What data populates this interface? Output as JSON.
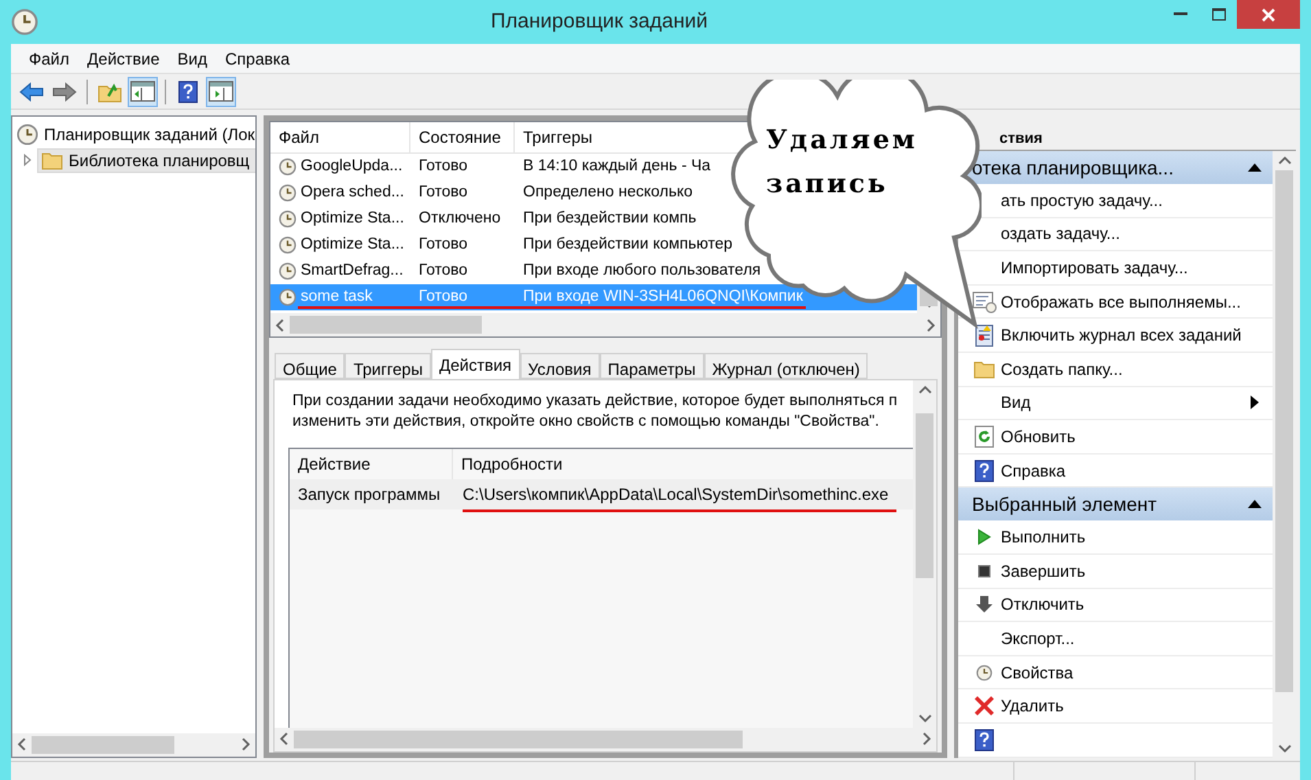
{
  "window": {
    "title": "Планировщик заданий"
  },
  "menu": [
    "Файл",
    "Действие",
    "Вид",
    "Справка"
  ],
  "toolbar": [
    {
      "kind": "back",
      "pressed": false
    },
    {
      "kind": "forward",
      "pressed": false
    },
    {
      "kind": "separator"
    },
    {
      "kind": "up",
      "pressed": false
    },
    {
      "kind": "tree",
      "pressed": true
    },
    {
      "kind": "separator"
    },
    {
      "kind": "help",
      "pressed": false
    },
    {
      "kind": "actions",
      "pressed": true
    }
  ],
  "tree": [
    {
      "label": "Планировщик заданий (Лок",
      "selected": false,
      "children": [
        {
          "label": "Библиотека планировщ",
          "selected": true,
          "expanded": false
        }
      ]
    }
  ],
  "task_table": {
    "columns": [
      "Файл",
      "Состояние",
      "Триггеры"
    ],
    "rows": [
      {
        "name": "GoogleUpda...",
        "status": "Готово",
        "trigger": "В 14:10 каждый день - Ча",
        "selected": false,
        "underlined": false
      },
      {
        "name": "Opera sched...",
        "status": "Готово",
        "trigger": "Определено несколько",
        "selected": false,
        "underlined": false
      },
      {
        "name": "Optimize Sta...",
        "status": "Отключено",
        "trigger": "При бездействии компь",
        "selected": false,
        "underlined": false
      },
      {
        "name": "Optimize Sta...",
        "status": "Готово",
        "trigger": "При бездействии компьютер",
        "selected": false,
        "underlined": false
      },
      {
        "name": "SmartDefrag...",
        "status": "Готово",
        "trigger": "При входе любого пользователя",
        "selected": false,
        "underlined": false
      },
      {
        "name": "some task",
        "status": "Готово",
        "trigger": "При входе WIN-3SH4L06QNQI\\Компик",
        "selected": true,
        "underlined": true
      }
    ]
  },
  "detail_tabs": [
    {
      "label": "Общие",
      "selected": false
    },
    {
      "label": "Триггеры",
      "selected": false
    },
    {
      "label": "Действия",
      "selected": true
    },
    {
      "label": "Условия",
      "selected": false
    },
    {
      "label": "Параметры",
      "selected": false
    },
    {
      "label": "Журнал (отключен)",
      "selected": false
    }
  ],
  "description_lines": [
    "При создании задачи необходимо указать действие, которое будет выполняться п",
    "изменить эти действия, откройте окно свойств с помощью команды \"Свойства\"."
  ],
  "actions_table": {
    "columns": [
      "Действие",
      "Подробности"
    ],
    "rows": [
      {
        "action": "Запуск программы",
        "details": "C:\\Users\\компик\\AppData\\Local\\SystemDir\\somethinc.exe",
        "underlined": true
      }
    ]
  },
  "actions_panel": {
    "title": "ствия",
    "sections": [
      {
        "title": "отека планировщика...",
        "expanded": true,
        "items": [
          {
            "label": "ать простую задачу...",
            "kind": "plain"
          },
          {
            "label": "оздать задачу...",
            "kind": "plain"
          },
          {
            "label": "Импортировать задачу...",
            "kind": "plain"
          },
          {
            "label": "Отображать все выполняемы...",
            "kind": "list"
          },
          {
            "label": "Включить журнал всех заданий",
            "kind": "log"
          },
          {
            "label": "Создать папку...",
            "kind": "folder"
          },
          {
            "label": "Вид",
            "kind": "plain",
            "submenu": true
          },
          {
            "label": "Обновить",
            "kind": "refresh"
          },
          {
            "label": "Справка",
            "kind": "help"
          }
        ]
      },
      {
        "title": "Выбранный элемент",
        "expanded": true,
        "items": [
          {
            "label": "Выполнить",
            "kind": "run"
          },
          {
            "label": "Завершить",
            "kind": "stop"
          },
          {
            "label": "Отключить",
            "kind": "disable"
          },
          {
            "label": "Экспорт...",
            "kind": "plain"
          },
          {
            "label": "Свойства",
            "kind": "clock"
          },
          {
            "label": "Удалить",
            "kind": "delete"
          },
          {
            "kind": "help"
          }
        ]
      }
    ]
  },
  "callout": {
    "lines": [
      "Удаляем",
      "запись"
    ]
  }
}
